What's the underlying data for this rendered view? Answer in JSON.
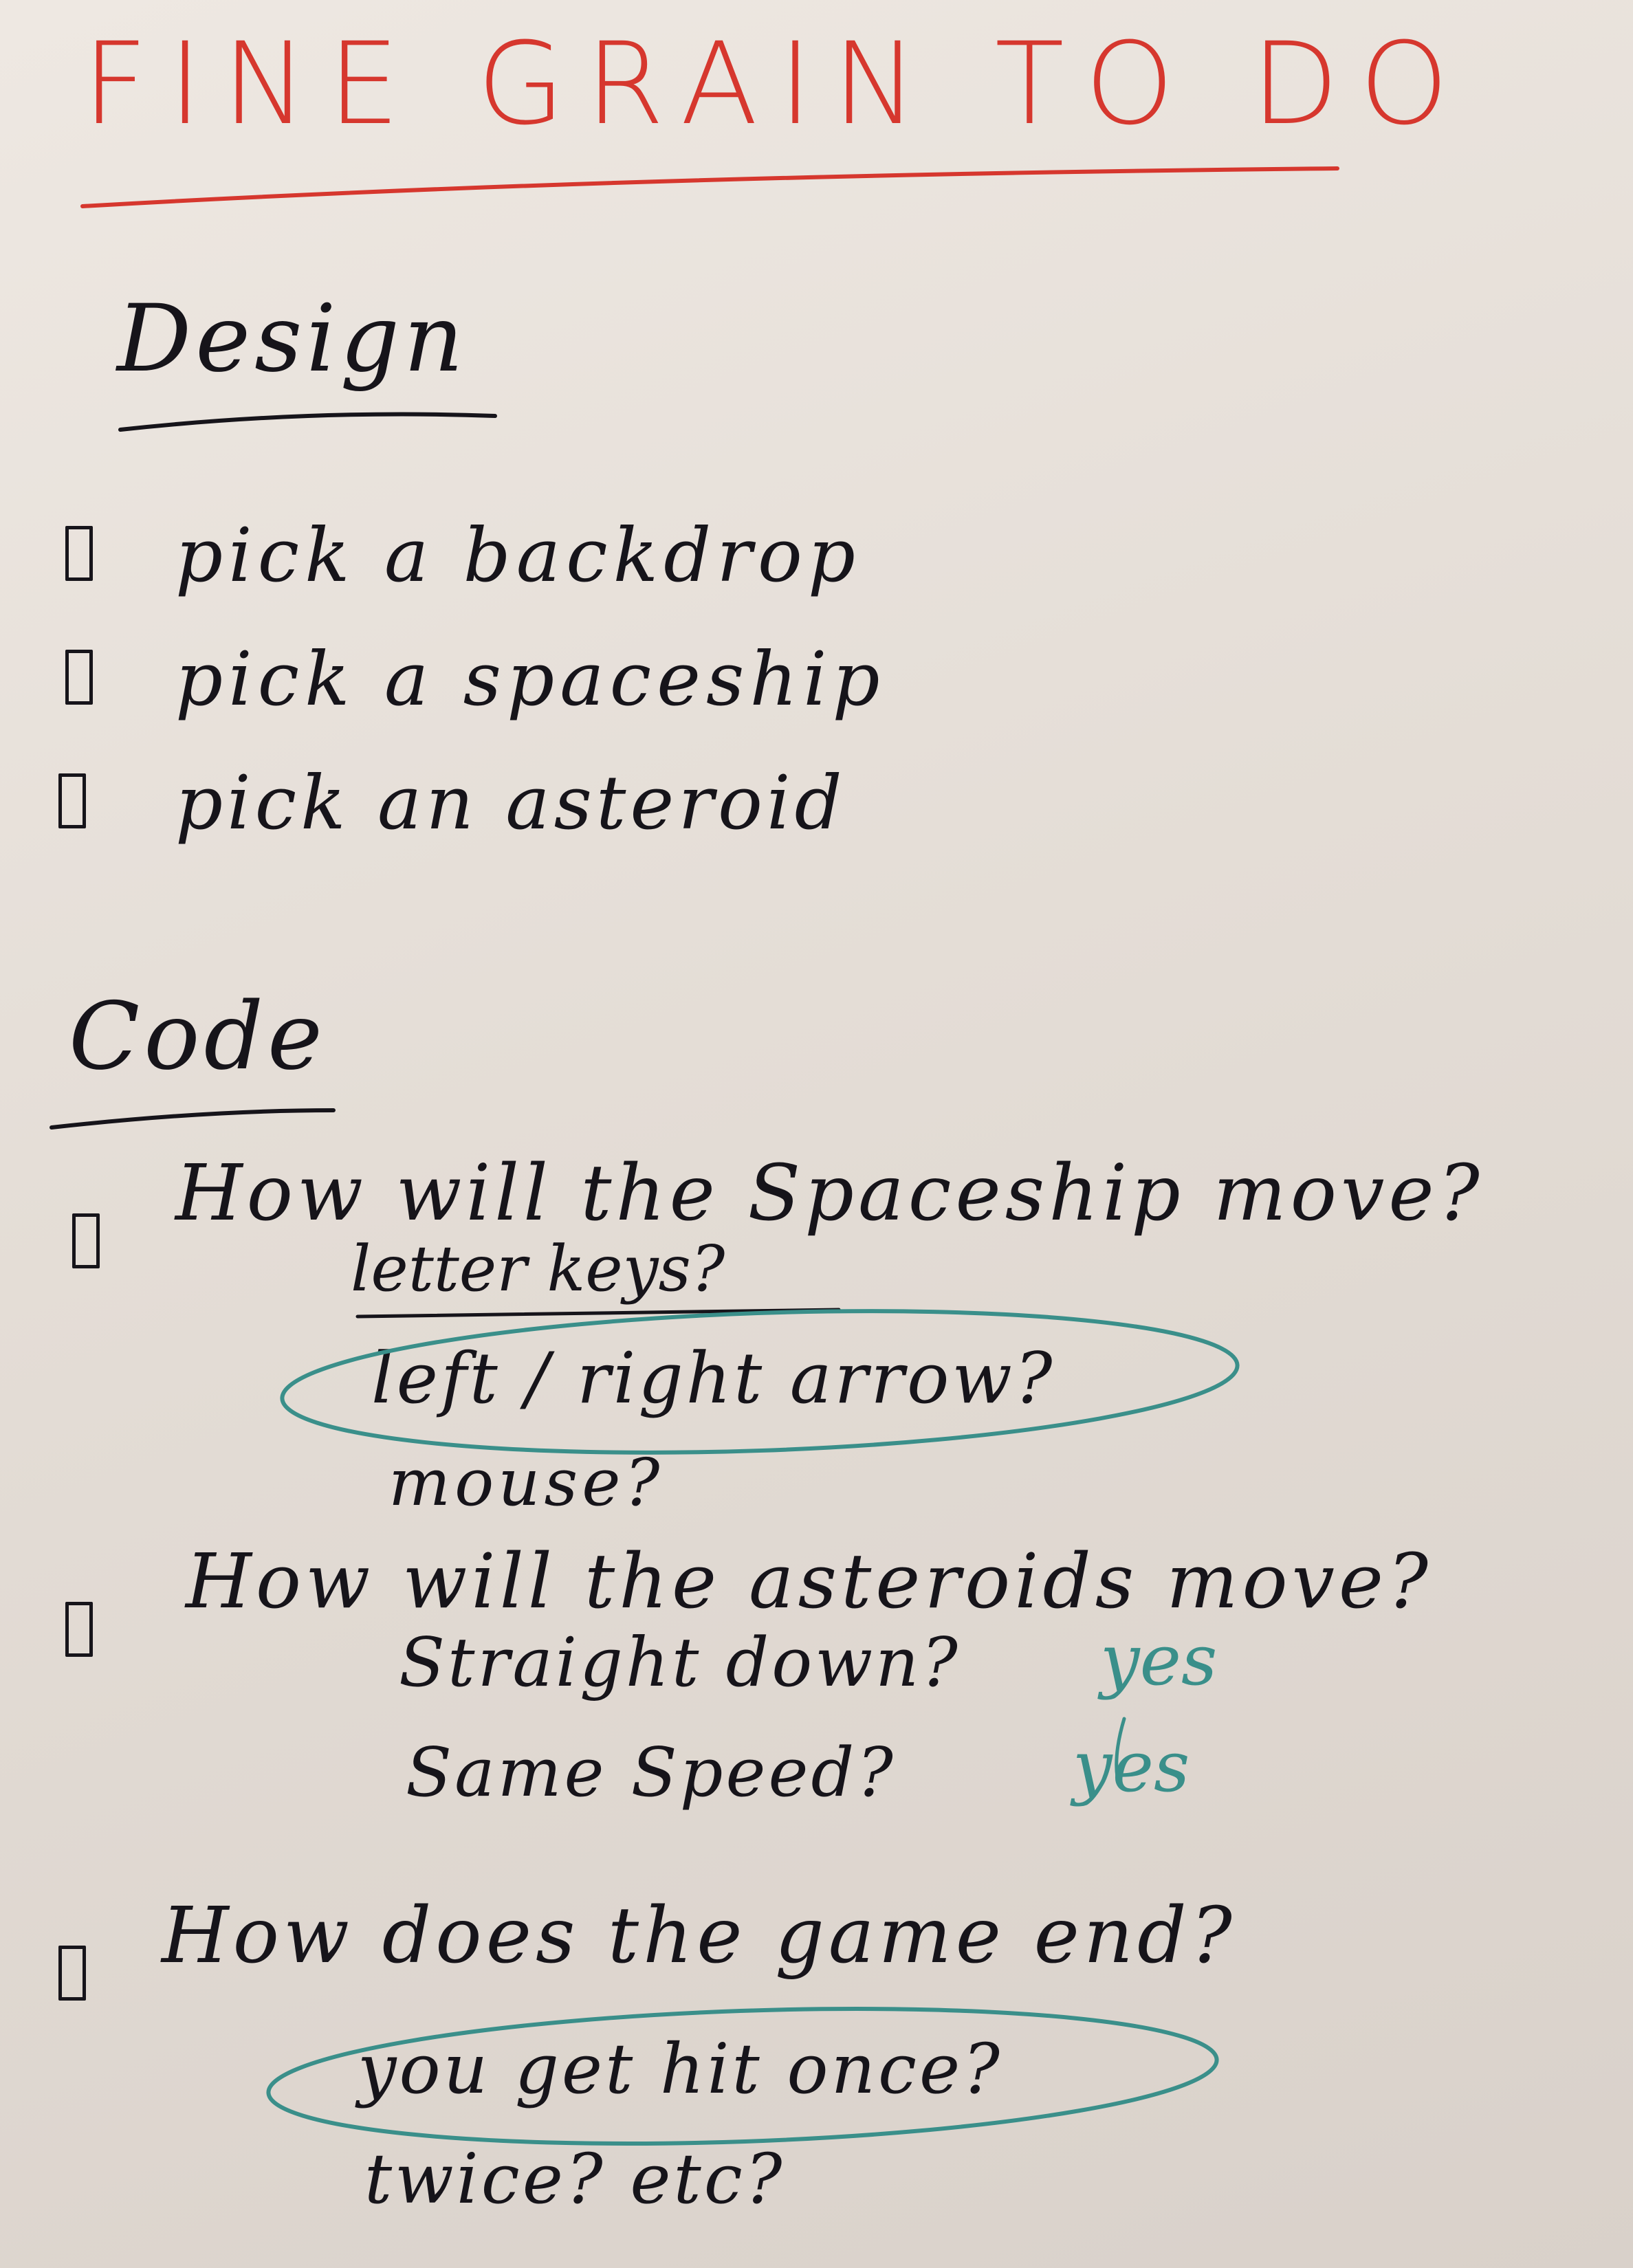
{
  "title": "FINE GRAIN TO DO",
  "design": {
    "heading": "Design",
    "items": [
      {
        "label": "pick a backdrop"
      },
      {
        "label": "pick a spaceship"
      },
      {
        "label": "pick an asteroid"
      }
    ]
  },
  "code": {
    "heading": "Code",
    "q1": {
      "label": "How will the Spaceship move?",
      "opt1": "letter keys?",
      "opt2": "left / right arrow?",
      "opt3": "mouse?"
    },
    "q2": {
      "label": "How will the asteroids move?",
      "opt1": "Straight down?",
      "ans1": "yes",
      "opt2": "Same Speed?",
      "ans2": "yes"
    },
    "q3": {
      "label": "How does the game end?",
      "opt1": "you get hit once?",
      "opt2": "twice? etc?"
    }
  },
  "colors": {
    "marker_red": "#d6372e",
    "marker_black": "#16141a",
    "marker_teal": "#3a8f8a"
  }
}
